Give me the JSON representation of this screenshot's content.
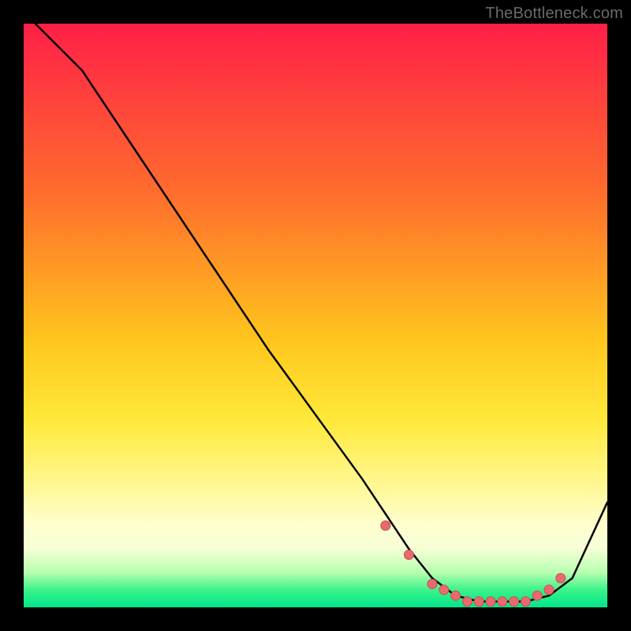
{
  "watermark": "TheBottleneck.com",
  "colors": {
    "frame": "#000000",
    "curve_stroke": "#000000",
    "marker_fill": "#e86a6d",
    "marker_stroke": "#c94e52"
  },
  "chart_data": {
    "type": "line",
    "title": "",
    "xlabel": "",
    "ylabel": "",
    "xlim": [
      0,
      100
    ],
    "ylim": [
      0,
      100
    ],
    "grid": false,
    "legend": false,
    "series": [
      {
        "name": "bottleneck-curve",
        "x": [
          2,
          10,
          18,
          26,
          34,
          42,
          50,
          58,
          62,
          66,
          70,
          74,
          78,
          82,
          86,
          90,
          94,
          100
        ],
        "y": [
          100,
          92,
          80,
          68,
          56,
          44,
          33,
          22,
          16,
          10,
          5,
          2,
          1,
          1,
          1,
          2,
          5,
          18
        ]
      }
    ],
    "markers": {
      "comment": "highlighted points along the trough",
      "x": [
        62,
        66,
        70,
        72,
        74,
        76,
        78,
        80,
        82,
        84,
        86,
        88,
        90,
        92
      ],
      "y": [
        14,
        9,
        4,
        3,
        2,
        1,
        1,
        1,
        1,
        1,
        1,
        2,
        3,
        5
      ]
    }
  }
}
